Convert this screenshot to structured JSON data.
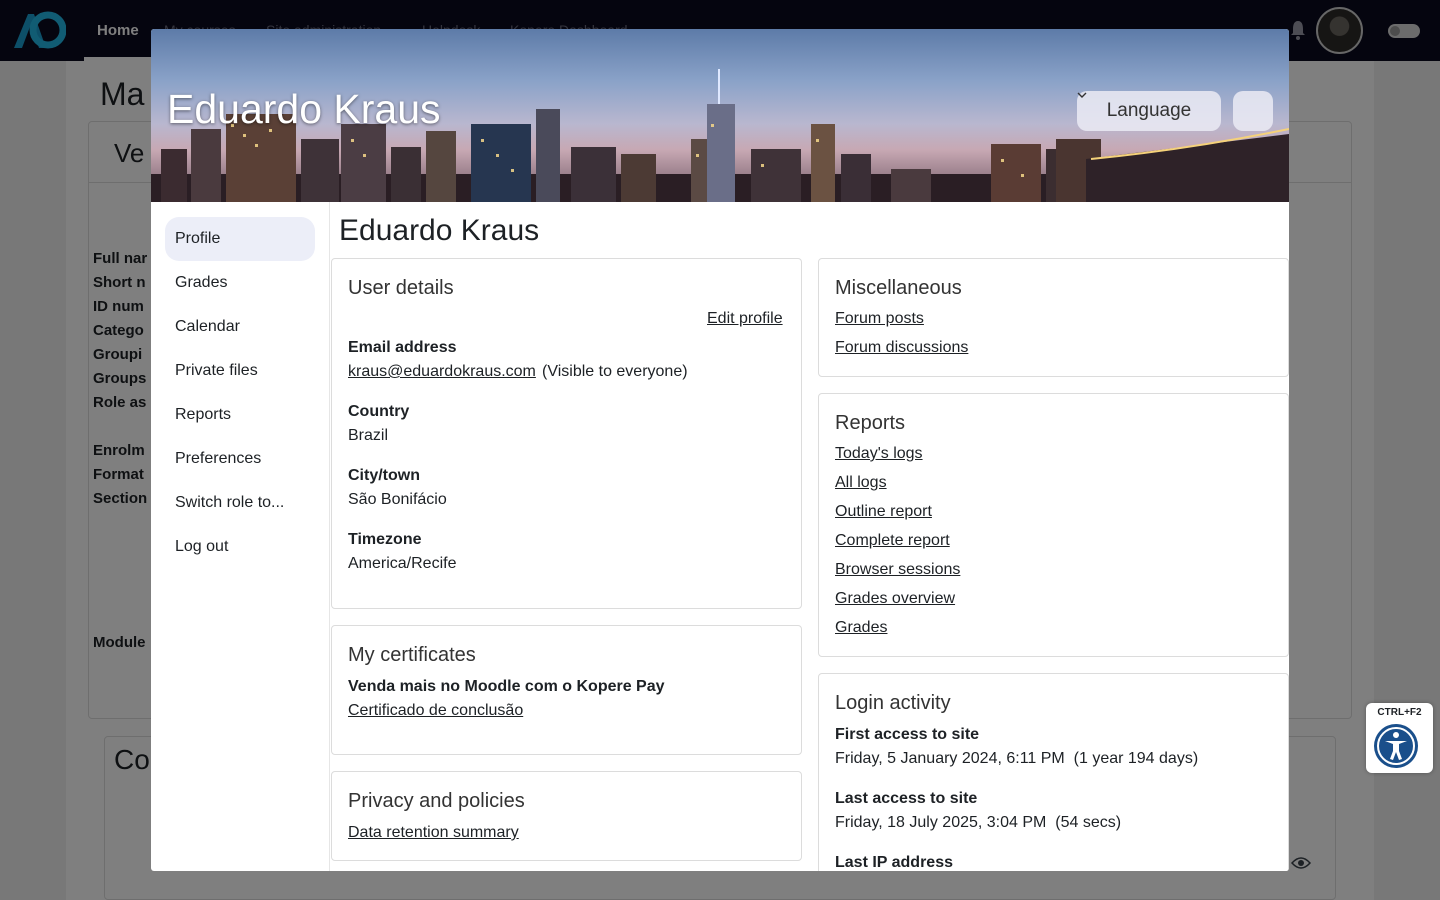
{
  "topnav": {
    "home_label": "Home",
    "faded_items": [
      "My courses",
      "Site administration",
      "Helpdesk",
      "Kopere Dashboard"
    ]
  },
  "background_page": {
    "title": "Ma",
    "card_heading": "Ve",
    "labels": [
      "Full nar",
      "Short n",
      "ID num",
      "Catego",
      "Groupi",
      "Groups",
      "Role as",
      "Enrolm",
      "Format",
      "Section",
      "Module"
    ],
    "card2_heading": "Co"
  },
  "modal": {
    "banner_title": "Eduardo Kraus",
    "language_label": "Language",
    "sidebar": {
      "items": [
        "Profile",
        "Grades",
        "Calendar",
        "Private files",
        "Reports",
        "Preferences",
        "Switch role to...",
        "Log out"
      ]
    },
    "main_title": "Eduardo Kraus",
    "user_details": {
      "title": "User details",
      "edit_profile": "Edit profile",
      "email_label": "Email address",
      "email_value": "kraus@eduardokraus.com",
      "email_visibility": "(Visible to everyone)",
      "country_label": "Country",
      "country_value": "Brazil",
      "city_label": "City/town",
      "city_value": "São Bonifácio",
      "timezone_label": "Timezone",
      "timezone_value": "America/Recife"
    },
    "certificates": {
      "title": "My certificates",
      "course": "Venda mais no Moodle com o Kopere Pay",
      "link": "Certificado de conclusão"
    },
    "privacy": {
      "title": "Privacy and policies",
      "link": "Data retention summary"
    },
    "misc": {
      "title": "Miscellaneous",
      "links": [
        "Forum posts",
        "Forum discussions"
      ]
    },
    "reports": {
      "title": "Reports",
      "links": [
        "Today's logs",
        "All logs",
        "Outline report",
        "Complete report",
        "Browser sessions",
        "Grades overview",
        "Grades"
      ]
    },
    "login": {
      "title": "Login activity",
      "first_label": "First access to site",
      "first_value": "Friday, 5 January 2024, 6:11 PM  (1 year 194 days)",
      "last_label": "Last access to site",
      "last_value": "Friday, 18 July 2025, 3:04 PM  (54 secs)",
      "ip_label": "Last IP address"
    }
  },
  "accessibility": {
    "shortcut": "CTRL+F2"
  },
  "colors": {
    "topbar": "#0b0a1f",
    "logo_primary": "#1a9fd0",
    "active_sidebar": "#eceef8"
  }
}
